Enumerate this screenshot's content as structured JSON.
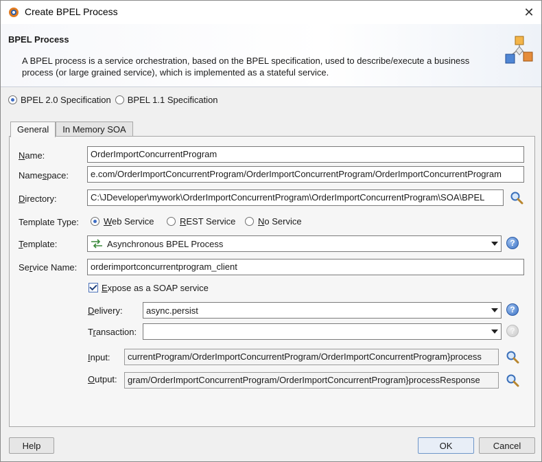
{
  "window": {
    "title": "Create BPEL Process",
    "close_glyph": "✕"
  },
  "banner": {
    "title": "BPEL Process",
    "description": "A BPEL process is a service orchestration, based on the BPEL specification, used to describe/execute a business process (or large grained service), which is implemented as a stateful service."
  },
  "spec": {
    "options": [
      {
        "label": "BPEL 2.0 Specification",
        "selected": true
      },
      {
        "label": "BPEL 1.1 Specification",
        "selected": false
      }
    ]
  },
  "tabs": [
    {
      "label": "General",
      "active": true
    },
    {
      "label": "In Memory SOA",
      "active": false
    }
  ],
  "form": {
    "name": {
      "label_pre": "",
      "label_u": "N",
      "label_post": "ame:",
      "value": "OrderImportConcurrentProgram"
    },
    "namespace": {
      "label_pre": "Name",
      "label_u": "s",
      "label_post": "pace:",
      "value": "e.com/OrderImportConcurrentProgram/OrderImportConcurrentProgram/OrderImportConcurrentProgram"
    },
    "directory": {
      "label_pre": "",
      "label_u": "D",
      "label_post": "irectory:",
      "value": "C:\\JDeveloper\\mywork\\OrderImportConcurrentProgram\\OrderImportConcurrentProgram\\SOA\\BPEL"
    },
    "template_type": {
      "label": "Template Type:",
      "options": [
        {
          "label_pre": "",
          "label_u": "W",
          "label_post": "eb Service",
          "selected": true
        },
        {
          "label_pre": "",
          "label_u": "R",
          "label_post": "EST Service",
          "selected": false
        },
        {
          "label_pre": "",
          "label_u": "N",
          "label_post": "o Service",
          "selected": false
        }
      ]
    },
    "template": {
      "label_pre": "",
      "label_u": "T",
      "label_post": "emplate:",
      "value": "Asynchronous BPEL Process"
    },
    "service_name": {
      "label_pre": "Se",
      "label_u": "r",
      "label_post": "vice Name:",
      "value": "orderimportconcurrentprogram_client"
    },
    "expose": {
      "label_pre": "",
      "label_u": "E",
      "label_post": "xpose as a SOAP service",
      "checked": true
    },
    "delivery": {
      "label_pre": "",
      "label_u": "D",
      "label_post": "elivery:",
      "value": "async.persist"
    },
    "transaction": {
      "label_pre": "T",
      "label_u": "r",
      "label_post": "ansaction:",
      "value": ""
    },
    "input": {
      "label_pre": "",
      "label_u": "I",
      "label_post": "nput:",
      "value": "currentProgram/OrderImportConcurrentProgram/OrderImportConcurrentProgram}process"
    },
    "output": {
      "label_pre": "",
      "label_u": "O",
      "label_post": "utput:",
      "value": "gram/OrderImportConcurrentProgram/OrderImportConcurrentProgram}processResponse"
    }
  },
  "buttons": {
    "help": "Help",
    "ok": "OK",
    "cancel": "Cancel"
  },
  "colors": {
    "accent": "#3e6dc4",
    "default_button_border": "#6d95c8"
  }
}
